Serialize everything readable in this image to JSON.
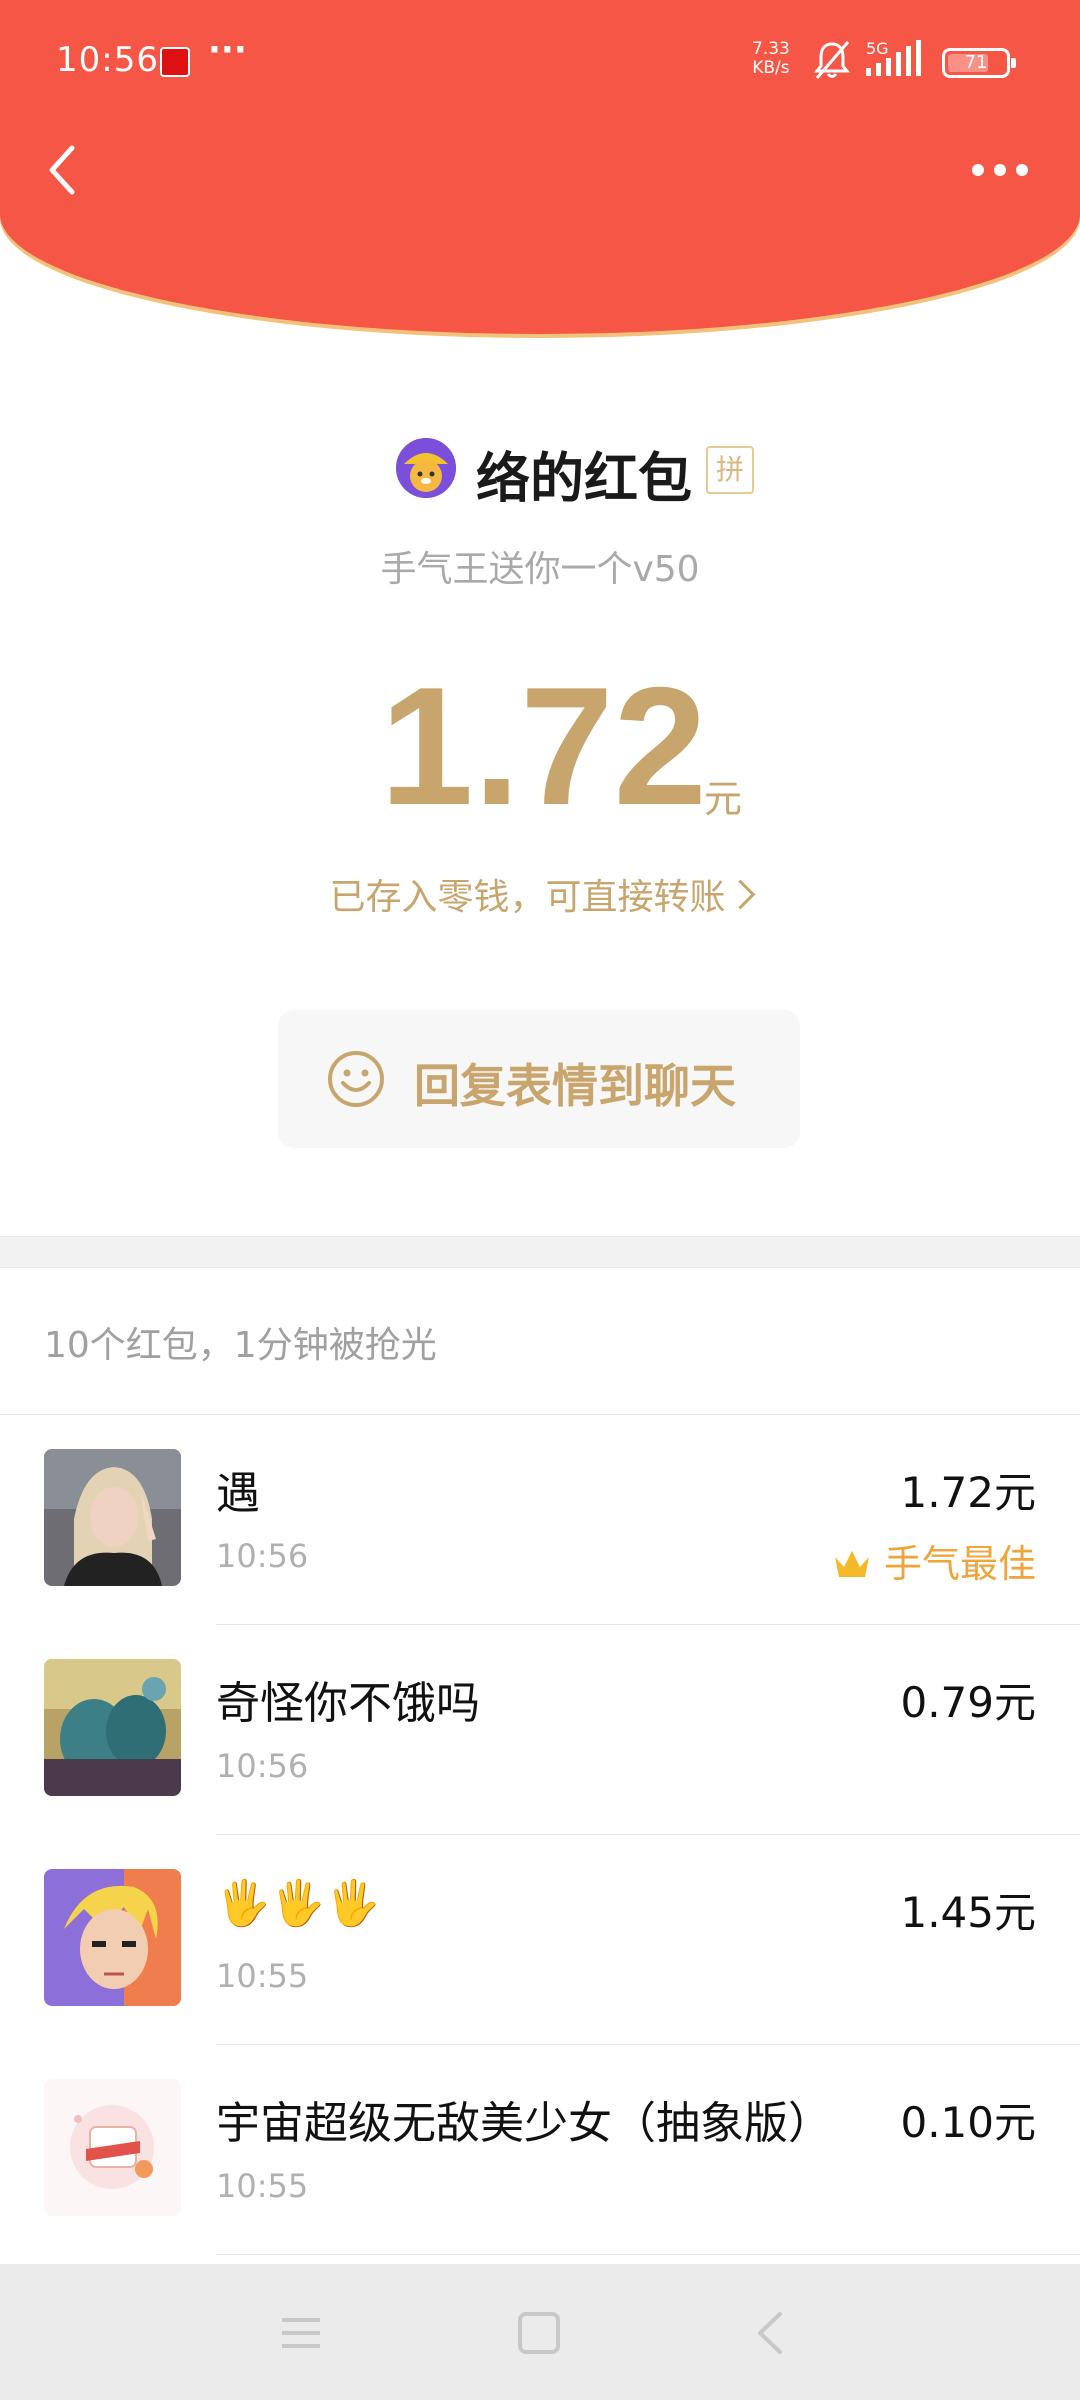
{
  "status_bar": {
    "time": "10:56",
    "more": "···",
    "speed_value": "7.33",
    "speed_unit": "KB/s",
    "network": "5G",
    "battery": "71",
    "battery_level": 0.71
  },
  "nav": {
    "back_icon": "chevron-left-icon",
    "more_icon": "more-dots-icon"
  },
  "packet": {
    "sender_name": "络的红包",
    "tag": "拼",
    "subtitle": "手气王送你一个v50",
    "amount": "1.72",
    "unit": "元",
    "deposit_text": "已存入零钱，可直接转账",
    "reply_button": "回复表情到聊天"
  },
  "list": {
    "summary": "10个红包，1分钟被抢光",
    "records": [
      {
        "name": "遇",
        "time": "10:56",
        "amount": "1.72元",
        "badge": "手气最佳"
      },
      {
        "name": "奇怪你不饿吗",
        "time": "10:56",
        "amount": "0.79元"
      },
      {
        "name": "🖐🖐🖐",
        "time": "10:55",
        "amount": "1.45元"
      },
      {
        "name": "宇宙超级无敌美少女（抽象版）",
        "time": "10:55",
        "amount": "0.10元"
      }
    ]
  },
  "colors": {
    "header_red": "#f65646",
    "gold": "#c9a56e",
    "best_orange": "#f0a43a"
  }
}
